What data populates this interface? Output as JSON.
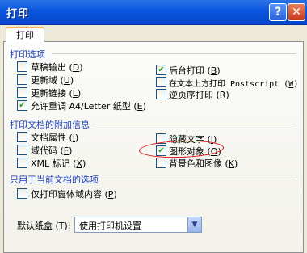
{
  "window": {
    "title": "打印",
    "help_glyph": "?",
    "close_glyph": "✕"
  },
  "tab": {
    "label": "打印"
  },
  "groups": {
    "print_options": "打印选项",
    "additional_info": "打印文档的附加信息",
    "current_doc_only": "只用于当前文档的选项"
  },
  "options": {
    "draft_output": {
      "label": "草稿输出",
      "key": "D",
      "checked": false
    },
    "update_fields": {
      "label": "更新域",
      "key": "U",
      "checked": false
    },
    "update_links": {
      "label": "更新链接",
      "key": "L",
      "checked": false
    },
    "allow_a4": {
      "label": "允许重调 A4/Letter 纸型",
      "key": "E",
      "checked": true
    },
    "background_print": {
      "label": "后台打印",
      "key": "B",
      "checked": true
    },
    "postscript_over_text": {
      "label": "在文本上方打印 Postscript",
      "key": "W",
      "checked": false
    },
    "reverse_order": {
      "label": "逆页序打印",
      "key": "R",
      "checked": false
    },
    "document_properties": {
      "label": "文档属性",
      "key": "I",
      "checked": false
    },
    "field_codes": {
      "label": "域代码",
      "key": "F",
      "checked": false
    },
    "xml_tags": {
      "label": "XML 标记",
      "key": "X",
      "checked": false
    },
    "hidden_text": {
      "label": "隐藏文字",
      "key": "I",
      "checked": false
    },
    "drawing_objects": {
      "label": "图形对象",
      "key": "O",
      "checked": true
    },
    "background_colors": {
      "label": "背景色和图像",
      "key": "K",
      "checked": false
    },
    "form_data_only": {
      "label": "仅打印窗体域内容",
      "key": "P",
      "checked": false
    }
  },
  "default_tray": {
    "label": "默认纸盒",
    "key": "T",
    "value": "使用打印机设置"
  },
  "colors": {
    "title_bar": "#0a55df",
    "group_label": "#1b3fb8",
    "annotation": "#d11111"
  }
}
